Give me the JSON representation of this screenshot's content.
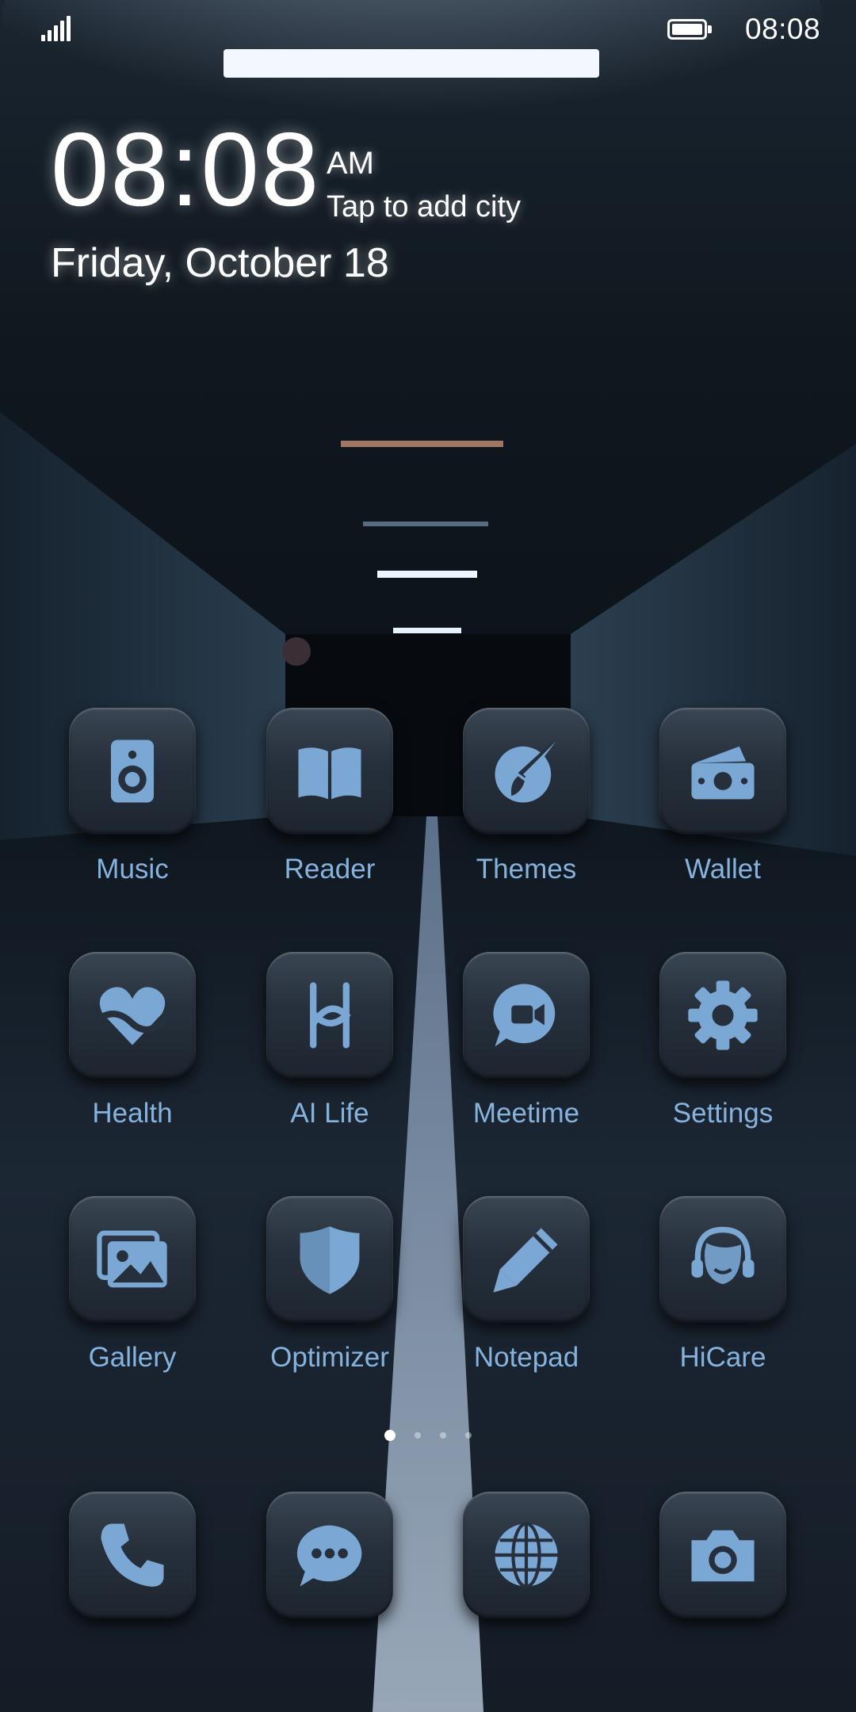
{
  "status_bar": {
    "time": "08:08",
    "signal_icon": "signal-icon",
    "battery_icon": "battery-icon"
  },
  "clock_widget": {
    "time": "08:08",
    "ampm": "AM",
    "city_prompt": "Tap to add city",
    "date": "Friday, October 18"
  },
  "apps": [
    {
      "label": "Music",
      "icon": "music-icon"
    },
    {
      "label": "Reader",
      "icon": "book-icon"
    },
    {
      "label": "Themes",
      "icon": "themes-brush-icon"
    },
    {
      "label": "Wallet",
      "icon": "wallet-icon"
    },
    {
      "label": "Health",
      "icon": "heart-icon"
    },
    {
      "label": "AI Life",
      "icon": "ai-life-icon"
    },
    {
      "label": "Meetime",
      "icon": "video-chat-icon"
    },
    {
      "label": "Settings",
      "icon": "gear-icon"
    },
    {
      "label": "Gallery",
      "icon": "gallery-icon"
    },
    {
      "label": "Optimizer",
      "icon": "shield-icon"
    },
    {
      "label": "Notepad",
      "icon": "pencil-icon"
    },
    {
      "label": "HiCare",
      "icon": "headset-icon"
    }
  ],
  "page_indicator": {
    "count": 4,
    "active": 1
  },
  "dock": [
    {
      "icon": "phone-icon"
    },
    {
      "icon": "message-icon"
    },
    {
      "icon": "browser-globe-icon"
    },
    {
      "icon": "camera-icon"
    }
  ],
  "colors": {
    "label": "#86b3de",
    "icon_glyph": "#7aa7d4",
    "tile": "#26303c"
  }
}
